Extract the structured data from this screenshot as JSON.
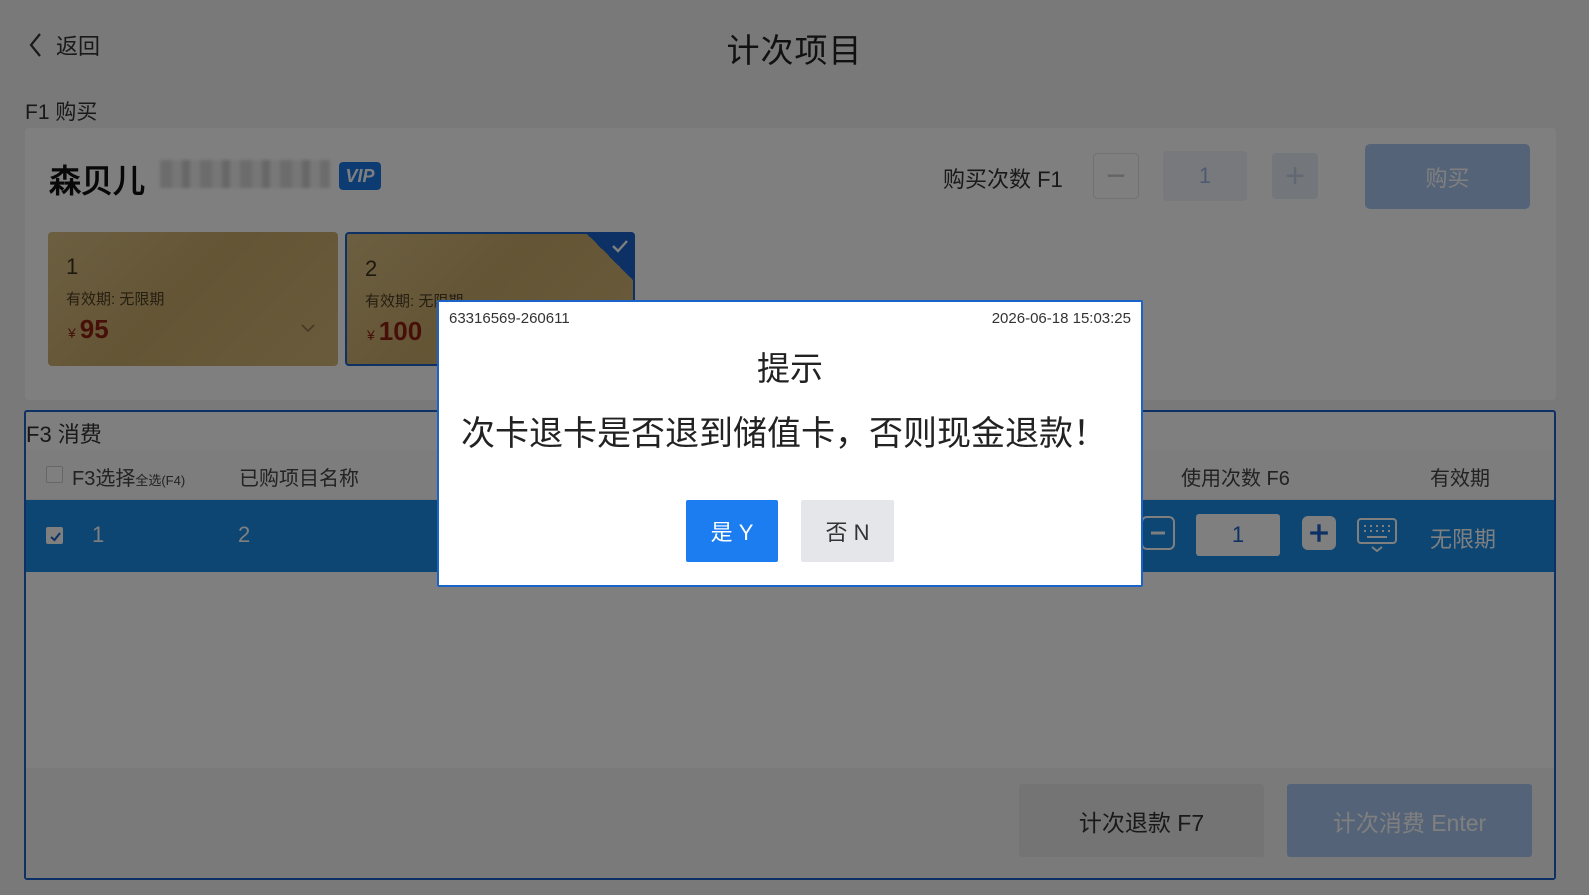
{
  "header": {
    "back_label": "返回",
    "title": "计次项目"
  },
  "buy": {
    "section_label": "F1 购买",
    "member_name": "森贝儿",
    "vip_label": "VIP",
    "count_label": "购买次数 F1",
    "count_value": "1",
    "minus_label": "−",
    "plus_label": "+",
    "buy_label": "购买",
    "cards": [
      {
        "no": "1",
        "validity": "有效期: 无限期",
        "currency": "¥",
        "price": "95",
        "selected": false
      },
      {
        "no": "2",
        "validity": "有效期: 无限期",
        "currency": "¥",
        "price": "100",
        "selected": true
      }
    ]
  },
  "consume": {
    "section_label": "F3 消费",
    "columns": {
      "select": "F3选择",
      "select_all": "全选(F4)",
      "name": "已购项目名称",
      "use_count": "使用次数 F6",
      "validity": "有效期"
    },
    "rows": [
      {
        "index": "1",
        "name": "2",
        "use_count": "1",
        "validity": "无限期",
        "checked": true
      }
    ],
    "refund_label": "计次退款 F7",
    "consume_label": "计次消费 Enter"
  },
  "dialog": {
    "id": "63316569-260611",
    "time": "2026-06-18 15:03:25",
    "title": "提示",
    "message": "次卡退卡是否退到储值卡，否则现金退款！",
    "yes_label": "是 Y",
    "no_label": "否 N"
  },
  "colors": {
    "accent": "#1a63c9",
    "row_highlight": "#1a8de6",
    "primary_button": "#1c7df0",
    "card_gold": "#d3b677",
    "price_red": "#8c1f0f"
  }
}
